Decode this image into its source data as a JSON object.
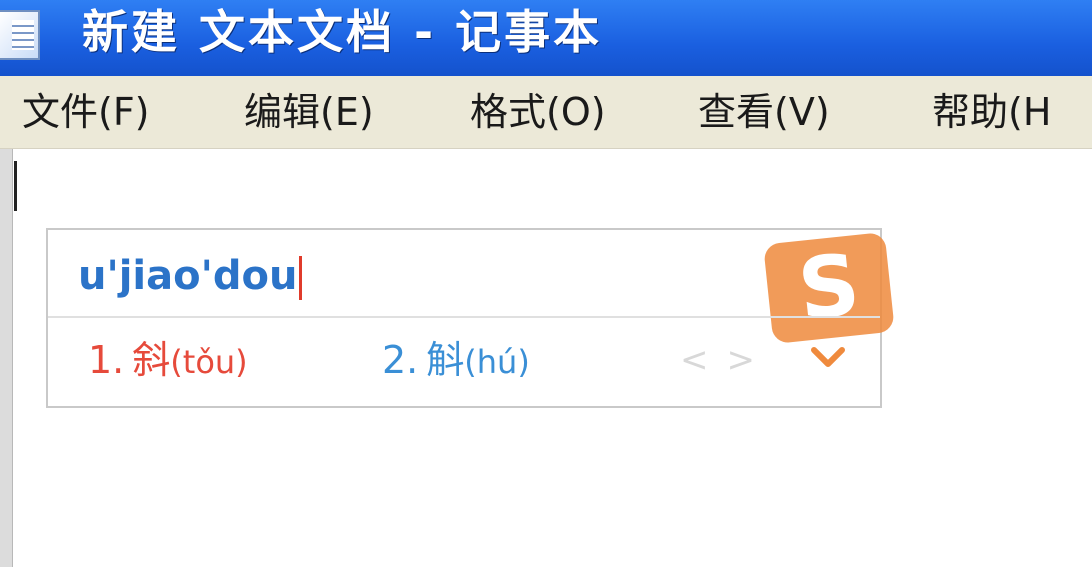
{
  "window": {
    "title": "新建 文本文档 - 记事本"
  },
  "menu": {
    "items": [
      {
        "label": "文件(F)"
      },
      {
        "label": "编辑(E)"
      },
      {
        "label": "格式(O)"
      },
      {
        "label": "查看(V)"
      },
      {
        "label": "帮助(H"
      }
    ]
  },
  "ime": {
    "composition": "u'jiao'dou",
    "candidates": [
      {
        "number": "1.",
        "char": "斜",
        "reading": "(tǒu)"
      },
      {
        "number": "2.",
        "char": "斛",
        "reading": "(hú)"
      }
    ],
    "prev_arrow": "<",
    "next_arrow": ">",
    "logo_letter": "S",
    "colors": {
      "composition": "#2b73c8",
      "candidate_1": "#e64a3b",
      "candidate_2": "#3a8fd6",
      "logo": "#ef8a3d"
    }
  }
}
